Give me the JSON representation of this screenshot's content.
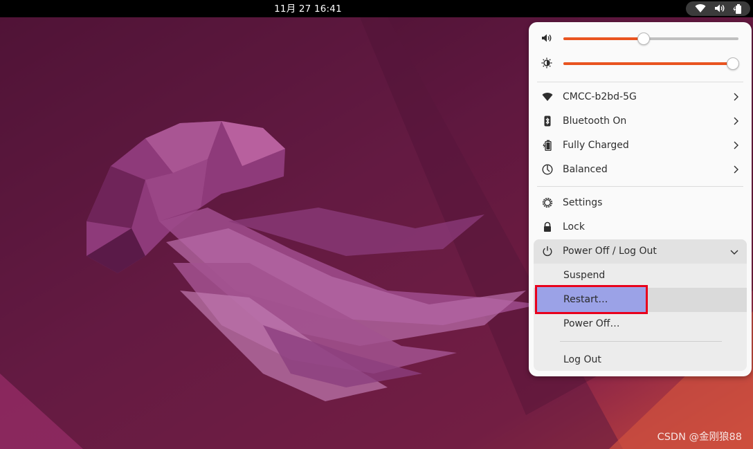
{
  "topbar": {
    "clock": "11月 27  16:41",
    "status_icons": [
      "wifi-icon",
      "volume-icon",
      "battery-icon"
    ]
  },
  "quick_settings": {
    "volume": {
      "icon": "volume-icon",
      "level": 0.46
    },
    "brightness": {
      "icon": "brightness-icon",
      "level": 0.97
    },
    "toggles": [
      {
        "icon": "wifi-icon",
        "label": "CMCC-b2bd-5G"
      },
      {
        "icon": "bluetooth-icon",
        "label": "Bluetooth On"
      },
      {
        "icon": "battery-icon",
        "label": "Fully Charged"
      },
      {
        "icon": "power-profile-icon",
        "label": "Balanced"
      }
    ],
    "actions": [
      {
        "icon": "gear-icon",
        "label": "Settings"
      },
      {
        "icon": "lock-icon",
        "label": "Lock"
      }
    ],
    "power_menu": {
      "icon": "power-icon",
      "label": "Power Off / Log Out",
      "items": [
        "Suspend",
        "Restart…",
        "Power Off…",
        "Log Out"
      ]
    }
  },
  "colors": {
    "accent": "#e95420",
    "highlight_border": "#e8001c",
    "highlight_fill": "#8c96eb"
  },
  "watermark": "CSDN @金刚狼88"
}
